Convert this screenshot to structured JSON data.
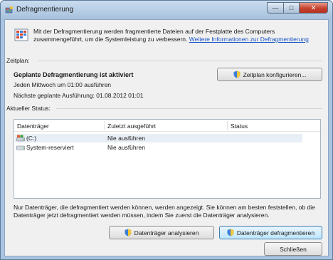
{
  "window": {
    "title": "Defragmentierung"
  },
  "intro": {
    "text": "Mit der Defragmentierung werden fragmentierte Dateien auf der Festplatte des Computers zusammengeführt, um die Systemleistung zu verbessern.",
    "link": "Weitere Informationen zur Defragmentierung"
  },
  "schedule": {
    "label": "Zeitplan:",
    "status": "Geplante Defragmentierung ist aktiviert",
    "frequency": "Jeden Mittwoch um 01:00 ausführen",
    "next_run": "Nächste geplante Ausführung: 01.08.2012 01:01",
    "configure_button": "Zeitplan konfigurieren..."
  },
  "current_status": {
    "label": "Aktueller Status:",
    "columns": [
      "Datenträger",
      "Zuletzt ausgeführt",
      "Status"
    ],
    "rows": [
      {
        "drive": "(C:)",
        "last_run": "Nie ausführen",
        "status": "",
        "icon": "system-drive-icon"
      },
      {
        "drive": "System-reserviert",
        "last_run": "Nie ausführen",
        "status": "",
        "icon": "drive-icon"
      }
    ]
  },
  "note": "Nur Datenträger, die defragmentiert werden können, werden angezeigt. Sie können am besten feststellen, ob die Datenträger jetzt defragmentiert werden müssen, indem Sie zuerst die Datenträger analysieren.",
  "buttons": {
    "analyze": "Datenträger analysieren",
    "defragment": "Datenträger defragmentieren",
    "close": "Schließen"
  },
  "colors": {
    "link": "#1a56c8",
    "selected_row": "#e8eef5",
    "focus_border": "#3c7fb1"
  }
}
